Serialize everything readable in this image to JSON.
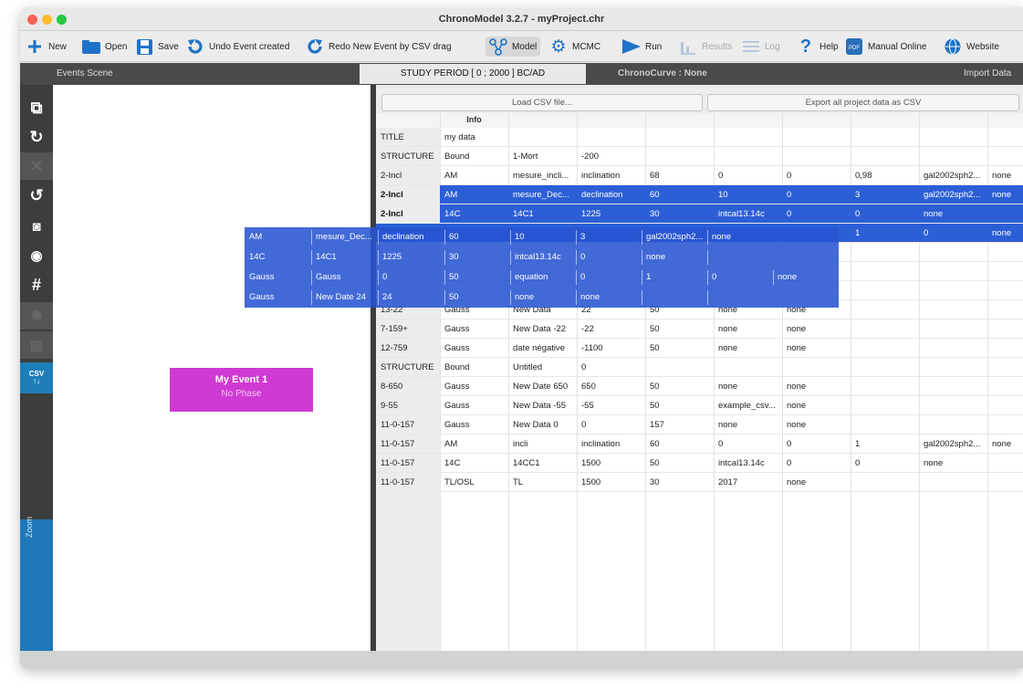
{
  "window": {
    "title": "ChronoModel 3.2.7 - myProject.chr"
  },
  "toolbar": {
    "new": "New",
    "open": "Open",
    "save": "Save",
    "undo": "Undo Event created",
    "redo": "Redo New Event by CSV drag",
    "model": "Model",
    "mcmc": "MCMC",
    "run": "Run",
    "results": "Results",
    "log": "Log",
    "help": "Help",
    "manual": "Manual Online",
    "website": "Website"
  },
  "subbar": {
    "events_scene": "Events Scene",
    "study_period": "STUDY PERIOD [ 0 ; 2000 ] BC/AD",
    "chronocurve": "ChronoCurve : None",
    "import_data": "Import Data"
  },
  "sidebar": {
    "csv_label": "CSV",
    "zoom_label": "Zoom"
  },
  "event": {
    "name": "My Event 1",
    "phase": "No Phase"
  },
  "import": {
    "load_csv": "Load CSV file...",
    "export_csv": "Export all project data as CSV",
    "info_header": "Info",
    "rows": [
      [
        "TITLE",
        "my data",
        "",
        "",
        "",
        "",
        "",
        "",
        "",
        ""
      ],
      [
        "STRUCTURE",
        "Bound",
        "1-Mort",
        "-200",
        "",
        "",
        "",
        "",
        "",
        ""
      ],
      [
        "2-Incl",
        "AM",
        "mesure_incli...",
        "inclination",
        "68",
        "0",
        "0",
        "0,98",
        "gal2002sph2...",
        "none"
      ],
      [
        "2-Incl",
        "AM",
        "mesure_Dec...",
        "declination",
        "60",
        "10",
        "0",
        "3",
        "gal2002sph2...",
        "none"
      ],
      [
        "2-Incl",
        "14C",
        "14C1",
        "1225",
        "30",
        "intcal13.14c",
        "0",
        "0",
        "none",
        ""
      ],
      [
        "",
        "",
        "",
        "",
        "",
        "",
        "",
        "1",
        "0",
        "none"
      ],
      [
        "",
        "",
        "",
        "",
        "",
        "",
        "",
        "",
        "",
        ""
      ],
      [
        "",
        "",
        "",
        "",
        "",
        "",
        "",
        "",
        "",
        ""
      ],
      [
        "",
        "",
        "",
        "",
        "",
        "",
        "",
        "",
        "",
        ""
      ],
      [
        "13-22",
        "Gauss",
        "New Data",
        "22",
        "50",
        "none",
        "none",
        "",
        "",
        ""
      ],
      [
        "7-159+",
        "Gauss",
        "New Data -22",
        "-22",
        "50",
        "none",
        "none",
        "",
        "",
        ""
      ],
      [
        "12-759",
        "Gauss",
        "date négative",
        "-1100",
        "50",
        "none",
        "none",
        "",
        "",
        ""
      ],
      [
        "STRUCTURE",
        "Bound",
        "Untitled",
        "0",
        "",
        "",
        "",
        "",
        "",
        ""
      ],
      [
        "8-650",
        "Gauss",
        "New Date 650",
        "650",
        "50",
        "none",
        "none",
        "",
        "",
        ""
      ],
      [
        "9-55",
        "Gauss",
        "New Data -55",
        "-55",
        "50",
        "example_csv...",
        "none",
        "",
        "",
        ""
      ],
      [
        "11-0-157",
        "Gauss",
        "New Data 0",
        "0",
        "157",
        "none",
        "none",
        "",
        "",
        ""
      ],
      [
        "11-0-157",
        "AM",
        "incli",
        "inclination",
        "60",
        "0",
        "0",
        "1",
        "gal2002sph2...",
        "none"
      ],
      [
        "11-0-157",
        "14C",
        "14CC1",
        "1500",
        "50",
        "intcal13.14c",
        "0",
        "0",
        "none",
        ""
      ],
      [
        "11-0-157",
        "TL/OSL",
        "TL",
        "1500",
        "30",
        "2017",
        "none",
        "",
        "",
        ""
      ]
    ],
    "drag_rows": [
      [
        "AM",
        "mesure_Dec...",
        "declination",
        "60",
        "10",
        "3",
        "gal2002sph2...",
        "none"
      ],
      [
        "14C",
        "14C1",
        "1225",
        "30",
        "intcal13.14c",
        "0",
        "none",
        ""
      ],
      [
        "Gauss",
        "Gauss",
        "0",
        "50",
        "equation",
        "0",
        "1",
        "0",
        "none"
      ],
      [
        "Gauss",
        "New Date 24",
        "24",
        "50",
        "none",
        "none",
        "",
        ""
      ]
    ]
  }
}
